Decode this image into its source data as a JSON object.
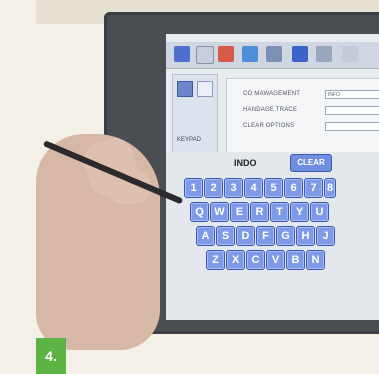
{
  "photo": {
    "badge": "4."
  },
  "screen": {
    "sidebar_label": "KEYPAD",
    "form": {
      "fields": [
        {
          "label": "CO MAWAGEMENT",
          "value": "INFO"
        },
        {
          "label": "HANDAGE TRACE",
          "value": ""
        },
        {
          "label": "CLEAR OPTIONS",
          "value": ""
        }
      ]
    },
    "keyboard": {
      "info_label": "INDO",
      "clear_label": "CLEAR",
      "rows": [
        [
          "1",
          "2",
          "3",
          "4",
          "5",
          "6",
          "7",
          "8"
        ],
        [
          "Q",
          "W",
          "E",
          "R",
          "T",
          "Y",
          "U"
        ],
        [
          "A",
          "S",
          "D",
          "F",
          "G",
          "H",
          "J"
        ],
        [
          "Z",
          "X",
          "C",
          "V",
          "B",
          "N"
        ]
      ]
    }
  },
  "colors": {
    "key": "#7d9ae8",
    "key_border": "#3a58b6",
    "bezel": "#4a4d52",
    "badge": "#5cb343"
  }
}
